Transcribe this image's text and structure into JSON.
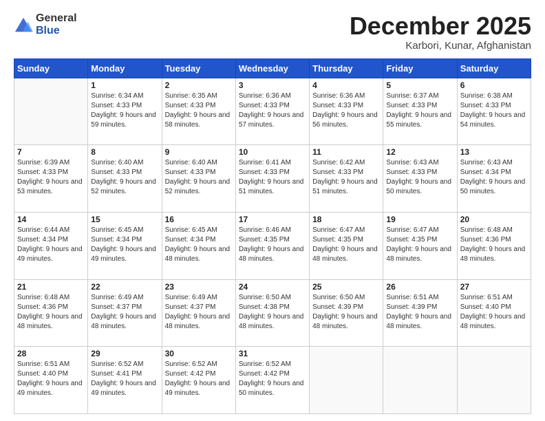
{
  "logo": {
    "general": "General",
    "blue": "Blue"
  },
  "header": {
    "month": "December 2025",
    "location": "Karbori, Kunar, Afghanistan"
  },
  "weekdays": [
    "Sunday",
    "Monday",
    "Tuesday",
    "Wednesday",
    "Thursday",
    "Friday",
    "Saturday"
  ],
  "weeks": [
    [
      {
        "day": "",
        "sunrise": "",
        "sunset": "",
        "daylight": ""
      },
      {
        "day": "1",
        "sunrise": "Sunrise: 6:34 AM",
        "sunset": "Sunset: 4:33 PM",
        "daylight": "Daylight: 9 hours and 59 minutes."
      },
      {
        "day": "2",
        "sunrise": "Sunrise: 6:35 AM",
        "sunset": "Sunset: 4:33 PM",
        "daylight": "Daylight: 9 hours and 58 minutes."
      },
      {
        "day": "3",
        "sunrise": "Sunrise: 6:36 AM",
        "sunset": "Sunset: 4:33 PM",
        "daylight": "Daylight: 9 hours and 57 minutes."
      },
      {
        "day": "4",
        "sunrise": "Sunrise: 6:36 AM",
        "sunset": "Sunset: 4:33 PM",
        "daylight": "Daylight: 9 hours and 56 minutes."
      },
      {
        "day": "5",
        "sunrise": "Sunrise: 6:37 AM",
        "sunset": "Sunset: 4:33 PM",
        "daylight": "Daylight: 9 hours and 55 minutes."
      },
      {
        "day": "6",
        "sunrise": "Sunrise: 6:38 AM",
        "sunset": "Sunset: 4:33 PM",
        "daylight": "Daylight: 9 hours and 54 minutes."
      }
    ],
    [
      {
        "day": "7",
        "sunrise": "Sunrise: 6:39 AM",
        "sunset": "Sunset: 4:33 PM",
        "daylight": "Daylight: 9 hours and 53 minutes."
      },
      {
        "day": "8",
        "sunrise": "Sunrise: 6:40 AM",
        "sunset": "Sunset: 4:33 PM",
        "daylight": "Daylight: 9 hours and 52 minutes."
      },
      {
        "day": "9",
        "sunrise": "Sunrise: 6:40 AM",
        "sunset": "Sunset: 4:33 PM",
        "daylight": "Daylight: 9 hours and 52 minutes."
      },
      {
        "day": "10",
        "sunrise": "Sunrise: 6:41 AM",
        "sunset": "Sunset: 4:33 PM",
        "daylight": "Daylight: 9 hours and 51 minutes."
      },
      {
        "day": "11",
        "sunrise": "Sunrise: 6:42 AM",
        "sunset": "Sunset: 4:33 PM",
        "daylight": "Daylight: 9 hours and 51 minutes."
      },
      {
        "day": "12",
        "sunrise": "Sunrise: 6:43 AM",
        "sunset": "Sunset: 4:33 PM",
        "daylight": "Daylight: 9 hours and 50 minutes."
      },
      {
        "day": "13",
        "sunrise": "Sunrise: 6:43 AM",
        "sunset": "Sunset: 4:34 PM",
        "daylight": "Daylight: 9 hours and 50 minutes."
      }
    ],
    [
      {
        "day": "14",
        "sunrise": "Sunrise: 6:44 AM",
        "sunset": "Sunset: 4:34 PM",
        "daylight": "Daylight: 9 hours and 49 minutes."
      },
      {
        "day": "15",
        "sunrise": "Sunrise: 6:45 AM",
        "sunset": "Sunset: 4:34 PM",
        "daylight": "Daylight: 9 hours and 49 minutes."
      },
      {
        "day": "16",
        "sunrise": "Sunrise: 6:45 AM",
        "sunset": "Sunset: 4:34 PM",
        "daylight": "Daylight: 9 hours and 48 minutes."
      },
      {
        "day": "17",
        "sunrise": "Sunrise: 6:46 AM",
        "sunset": "Sunset: 4:35 PM",
        "daylight": "Daylight: 9 hours and 48 minutes."
      },
      {
        "day": "18",
        "sunrise": "Sunrise: 6:47 AM",
        "sunset": "Sunset: 4:35 PM",
        "daylight": "Daylight: 9 hours and 48 minutes."
      },
      {
        "day": "19",
        "sunrise": "Sunrise: 6:47 AM",
        "sunset": "Sunset: 4:35 PM",
        "daylight": "Daylight: 9 hours and 48 minutes."
      },
      {
        "day": "20",
        "sunrise": "Sunrise: 6:48 AM",
        "sunset": "Sunset: 4:36 PM",
        "daylight": "Daylight: 9 hours and 48 minutes."
      }
    ],
    [
      {
        "day": "21",
        "sunrise": "Sunrise: 6:48 AM",
        "sunset": "Sunset: 4:36 PM",
        "daylight": "Daylight: 9 hours and 48 minutes."
      },
      {
        "day": "22",
        "sunrise": "Sunrise: 6:49 AM",
        "sunset": "Sunset: 4:37 PM",
        "daylight": "Daylight: 9 hours and 48 minutes."
      },
      {
        "day": "23",
        "sunrise": "Sunrise: 6:49 AM",
        "sunset": "Sunset: 4:37 PM",
        "daylight": "Daylight: 9 hours and 48 minutes."
      },
      {
        "day": "24",
        "sunrise": "Sunrise: 6:50 AM",
        "sunset": "Sunset: 4:38 PM",
        "daylight": "Daylight: 9 hours and 48 minutes."
      },
      {
        "day": "25",
        "sunrise": "Sunrise: 6:50 AM",
        "sunset": "Sunset: 4:39 PM",
        "daylight": "Daylight: 9 hours and 48 minutes."
      },
      {
        "day": "26",
        "sunrise": "Sunrise: 6:51 AM",
        "sunset": "Sunset: 4:39 PM",
        "daylight": "Daylight: 9 hours and 48 minutes."
      },
      {
        "day": "27",
        "sunrise": "Sunrise: 6:51 AM",
        "sunset": "Sunset: 4:40 PM",
        "daylight": "Daylight: 9 hours and 48 minutes."
      }
    ],
    [
      {
        "day": "28",
        "sunrise": "Sunrise: 6:51 AM",
        "sunset": "Sunset: 4:40 PM",
        "daylight": "Daylight: 9 hours and 49 minutes."
      },
      {
        "day": "29",
        "sunrise": "Sunrise: 6:52 AM",
        "sunset": "Sunset: 4:41 PM",
        "daylight": "Daylight: 9 hours and 49 minutes."
      },
      {
        "day": "30",
        "sunrise": "Sunrise: 6:52 AM",
        "sunset": "Sunset: 4:42 PM",
        "daylight": "Daylight: 9 hours and 49 minutes."
      },
      {
        "day": "31",
        "sunrise": "Sunrise: 6:52 AM",
        "sunset": "Sunset: 4:42 PM",
        "daylight": "Daylight: 9 hours and 50 minutes."
      },
      {
        "day": "",
        "sunrise": "",
        "sunset": "",
        "daylight": ""
      },
      {
        "day": "",
        "sunrise": "",
        "sunset": "",
        "daylight": ""
      },
      {
        "day": "",
        "sunrise": "",
        "sunset": "",
        "daylight": ""
      }
    ]
  ]
}
